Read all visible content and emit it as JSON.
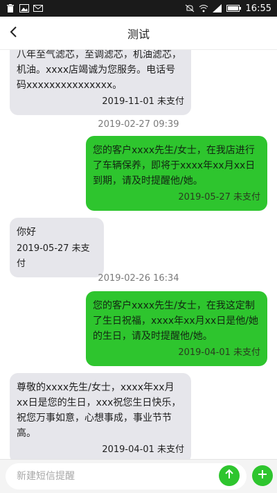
{
  "status_bar": {
    "time": "16:55"
  },
  "nav": {
    "title": "测试"
  },
  "messages": [
    {
      "side": "left",
      "timestamp": "",
      "text": "八年至气滤芯，至调滤芯，机油滤芯，机油。xxxx店竭诚为您服务。电话号码xxxxxxxxxxxxxxx。",
      "meta": "2019-11-01  未支付"
    },
    {
      "side": "right",
      "timestamp": "2019-02-27 09:39",
      "text": "您的客户xxxx先生/女士，在我店进行了车辆保养，即将于xxxx年xx月xx日到期，请及时提醒他/她。",
      "meta": "2019-05-27  未支付"
    },
    {
      "side": "left",
      "timestamp": "",
      "text": "你好",
      "meta": "2019-05-27  未支付"
    },
    {
      "side": "right",
      "timestamp": "2019-02-26 16:34",
      "text": "您的客户xxxx先生/女士，在我这定制了生日祝福，xxxx年xx月xx日是他/她的生日，请及时提醒他/她。",
      "meta": "2019-04-01  未支付"
    },
    {
      "side": "left",
      "timestamp": "",
      "text": "尊敬的xxxx先生/女士，xxxx年xx月xx日是您的生日，xxx祝您生日快乐，祝您万事如意，心想事成，事业节节高。",
      "meta": "2019-04-01  未支付"
    }
  ],
  "input": {
    "placeholder": "新建短信提醒"
  },
  "colors": {
    "accent": "#2ec52e",
    "bubble_left": "#e6e6eb",
    "status_bar": "#1a1a1a"
  },
  "icons": {
    "status_left": [
      "trash-icon",
      "image-icon",
      "mail-icon"
    ],
    "status_right": [
      "mute-icon",
      "wifi-icon",
      "signal-icon",
      "battery-icon"
    ],
    "nav": "back-arrow-icon",
    "send": "send-arrow-up-icon",
    "add": "add-icon"
  }
}
